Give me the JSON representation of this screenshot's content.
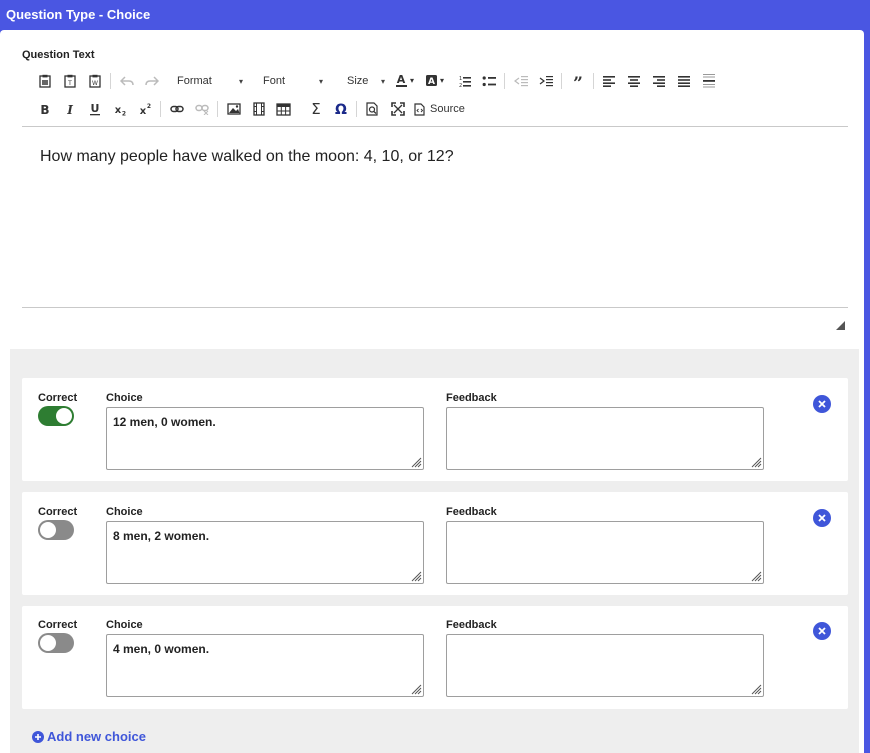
{
  "window": {
    "title": "Question Type - Choice"
  },
  "question": {
    "label": "Question Text",
    "text": "How many people have walked on the moon: 4, 10, or 12?"
  },
  "toolbar": {
    "format_label": "Format",
    "font_label": "Font",
    "size_label": "Size",
    "source_label": "Source",
    "icons_row1": [
      "paste-icon",
      "paste-text-icon",
      "paste-word-icon",
      "undo-icon",
      "redo-icon",
      "text-color-icon",
      "bg-color-icon",
      "numbered-list-icon",
      "bulleted-list-icon",
      "outdent-icon",
      "indent-icon",
      "blockquote-icon",
      "align-left-icon",
      "align-center-icon",
      "align-right-icon",
      "justify-icon",
      "horizontal-line-icon"
    ],
    "icons_row2": [
      "bold-icon",
      "italic-icon",
      "underline-icon",
      "subscript-icon",
      "superscript-icon",
      "link-icon",
      "unlink-icon",
      "image-icon",
      "video-icon",
      "table-icon",
      "sigma-icon",
      "omega-icon",
      "preview-icon",
      "maximize-icon",
      "source-icon"
    ]
  },
  "choices": {
    "correct_label": "Correct",
    "choice_label": "Choice",
    "feedback_label": "Feedback",
    "items": [
      {
        "correct": true,
        "choice": "12 men, 0 women.",
        "feedback": ""
      },
      {
        "correct": false,
        "choice": "8 men, 2 women.",
        "feedback": ""
      },
      {
        "correct": false,
        "choice": "4 men, 0 women.",
        "feedback": ""
      }
    ],
    "add_label": "Add new choice"
  },
  "colors": {
    "header_bg": "#4a56e2",
    "accent": "#3f56d9",
    "toggle_on": "#2e7d32",
    "toggle_off": "#8a8a8a"
  }
}
